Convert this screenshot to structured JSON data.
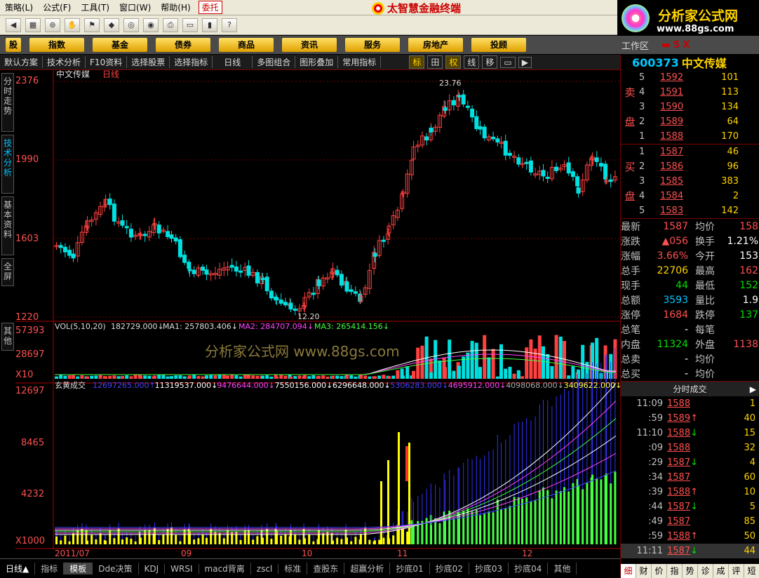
{
  "menu": {
    "items": [
      "策略(L)",
      "公式(F)",
      "工具(T)",
      "窗口(W)",
      "帮助(H)"
    ],
    "highlight": "委托",
    "app_title": "太智慧金融终端"
  },
  "brand": {
    "title": "分析家公式网",
    "url": "www.88gs.com"
  },
  "categories": [
    "股",
    "指数",
    "基金",
    "债券",
    "商品",
    "资讯",
    "服务",
    "房地产",
    "投顾"
  ],
  "workarea": {
    "label": "工作区",
    "controls": "▬ 5 X"
  },
  "analysis_bar": {
    "items": [
      "默认方案",
      "技术分析",
      "F10资料",
      "选择股票",
      "选择指标",
      "日线",
      "多图组合",
      "图形叠加",
      "常用指标"
    ],
    "tools": [
      "标",
      "田",
      "权",
      "线",
      "移"
    ]
  },
  "left_tabs": [
    "分时走势",
    "技术分析",
    "基本资料",
    "全屏",
    "其他"
  ],
  "chart": {
    "title": "中文传媒",
    "period_label": "日线",
    "price_axis": [
      "2376",
      "1990",
      "1603",
      "1220"
    ],
    "high_label": "23.76",
    "low_label": "12.20",
    "volume": {
      "label": "VOL(5,10,20)",
      "vol": "182729.000↓",
      "ma1": "MA1: 257803.406↓",
      "ma2": "MA2: 284707.094↓",
      "ma3": "MA3: 265414.156↓",
      "axis": [
        "57393",
        "28697",
        "X10"
      ]
    },
    "indicator": {
      "label": "玄黄成交",
      "values": [
        "12697265.000↑",
        "11319537.000↓",
        "9476644.000↓",
        "7550156.000↓",
        "6296648.000↓",
        "5306283.000↓",
        "4695912.000↓",
        "4098068.000↓",
        "3409622.000↓"
      ],
      "value_colors": [
        "#4444ff",
        "#ffffff",
        "#ff44ff",
        "#ffffff",
        "#ffffff",
        "#4444ff",
        "#ff44ff",
        "#aaaaaa",
        "#ffff44"
      ],
      "axis": [
        "12697",
        "8465",
        "4232",
        "X1000"
      ]
    },
    "date_labels": [
      "2011/07",
      "09",
      "10",
      "11",
      "12"
    ],
    "watermark": "分析家公式网  www.88gs.com",
    "chart_data": {
      "type": "candlestick",
      "title": "中文传媒 日线",
      "ylim": [
        1220,
        2376
      ],
      "high": 23.76,
      "low": 12.2
    }
  },
  "quote": {
    "code": "600373",
    "name": "中文传媒",
    "asks": [
      {
        "idx": "5",
        "price": "1592",
        "vol": "101"
      },
      {
        "idx": "4",
        "price": "1591",
        "vol": "113"
      },
      {
        "idx": "3",
        "price": "1590",
        "vol": "134"
      },
      {
        "idx": "2",
        "price": "1589",
        "vol": "64"
      },
      {
        "idx": "1",
        "price": "1588",
        "vol": "170"
      }
    ],
    "bids": [
      {
        "idx": "1",
        "price": "1587",
        "vol": "46"
      },
      {
        "idx": "2",
        "price": "1586",
        "vol": "96"
      },
      {
        "idx": "3",
        "price": "1585",
        "vol": "383"
      },
      {
        "idx": "4",
        "price": "1584",
        "vol": "2"
      },
      {
        "idx": "5",
        "price": "1583",
        "vol": "142"
      }
    ],
    "ask_label": [
      "卖",
      "盘"
    ],
    "bid_label": [
      "买",
      "盘"
    ],
    "stats": [
      {
        "l1": "最新",
        "v1": "1587",
        "c1": "red",
        "l2": "均价",
        "v2": "158",
        "c2": "red"
      },
      {
        "l1": "涨跌",
        "v1": "▲056",
        "c1": "red",
        "l2": "换手",
        "v2": "1.21%",
        "c2": "white"
      },
      {
        "l1": "涨幅",
        "v1": "3.66%",
        "c1": "red",
        "l2": "今开",
        "v2": "153",
        "c2": "white"
      },
      {
        "l1": "总手",
        "v1": "22706",
        "c1": "yellow",
        "l2": "最高",
        "v2": "162",
        "c2": "red"
      },
      {
        "l1": "现手",
        "v1": "44",
        "c1": "green",
        "l2": "最低",
        "v2": "152",
        "c2": "green"
      },
      {
        "l1": "总额",
        "v1": "3593",
        "c1": "cyan",
        "l2": "量比",
        "v2": "1.9",
        "c2": "white"
      },
      {
        "l1": "涨停",
        "v1": "1684",
        "c1": "red",
        "l2": "跌停",
        "v2": "137",
        "c2": "green"
      },
      {
        "l1": "总笔",
        "v1": "-",
        "c1": "white",
        "l2": "每笔",
        "v2": "",
        "c2": "white"
      },
      {
        "l1": "内盘",
        "v1": "11324",
        "c1": "green",
        "l2": "外盘",
        "v2": "1138",
        "c2": "red"
      },
      {
        "l1": "总卖",
        "v1": "-",
        "c1": "white",
        "l2": "均价",
        "v2": "",
        "c2": "white"
      },
      {
        "l1": "总买",
        "v1": "-",
        "c1": "white",
        "l2": "均价",
        "v2": "",
        "c2": "white"
      }
    ],
    "ticks_title": "分时成交",
    "ticks": [
      {
        "time": "11:09",
        "price": "1588",
        "vol": "1",
        "arrow": ""
      },
      {
        "time": ":59",
        "price": "1589",
        "vol": "40",
        "arrow": "↑"
      },
      {
        "time": "11:10",
        "price": "1588",
        "vol": "15",
        "arrow": "↓"
      },
      {
        "time": ":09",
        "price": "1588",
        "vol": "32",
        "arrow": ""
      },
      {
        "time": ":29",
        "price": "1587",
        "vol": "4",
        "arrow": "↓"
      },
      {
        "time": ":34",
        "price": "1587",
        "vol": "60",
        "arrow": ""
      },
      {
        "time": ":39",
        "price": "1588",
        "vol": "10",
        "arrow": "↑"
      },
      {
        "time": ":44",
        "price": "1587",
        "vol": "5",
        "arrow": "↓"
      },
      {
        "time": ":49",
        "price": "1587",
        "vol": "85",
        "arrow": ""
      },
      {
        "time": ":59",
        "price": "1588",
        "vol": "50",
        "arrow": "↑"
      },
      {
        "time": "11:11",
        "price": "1587",
        "vol": "44",
        "arrow": "↓"
      }
    ],
    "tabs": [
      "细",
      "财",
      "价",
      "指",
      "势",
      "诊",
      "成",
      "评",
      "短"
    ]
  },
  "bottom_tabs": [
    "指标",
    "模板",
    "Dde决策",
    "KDJ",
    "WRSI",
    "macd背离",
    "zscl",
    "标准",
    "查股东",
    "超赢分析",
    "抄底01",
    "抄底02",
    "抄底03",
    "抄底04",
    "其他"
  ],
  "bottom_period": "日线▲"
}
